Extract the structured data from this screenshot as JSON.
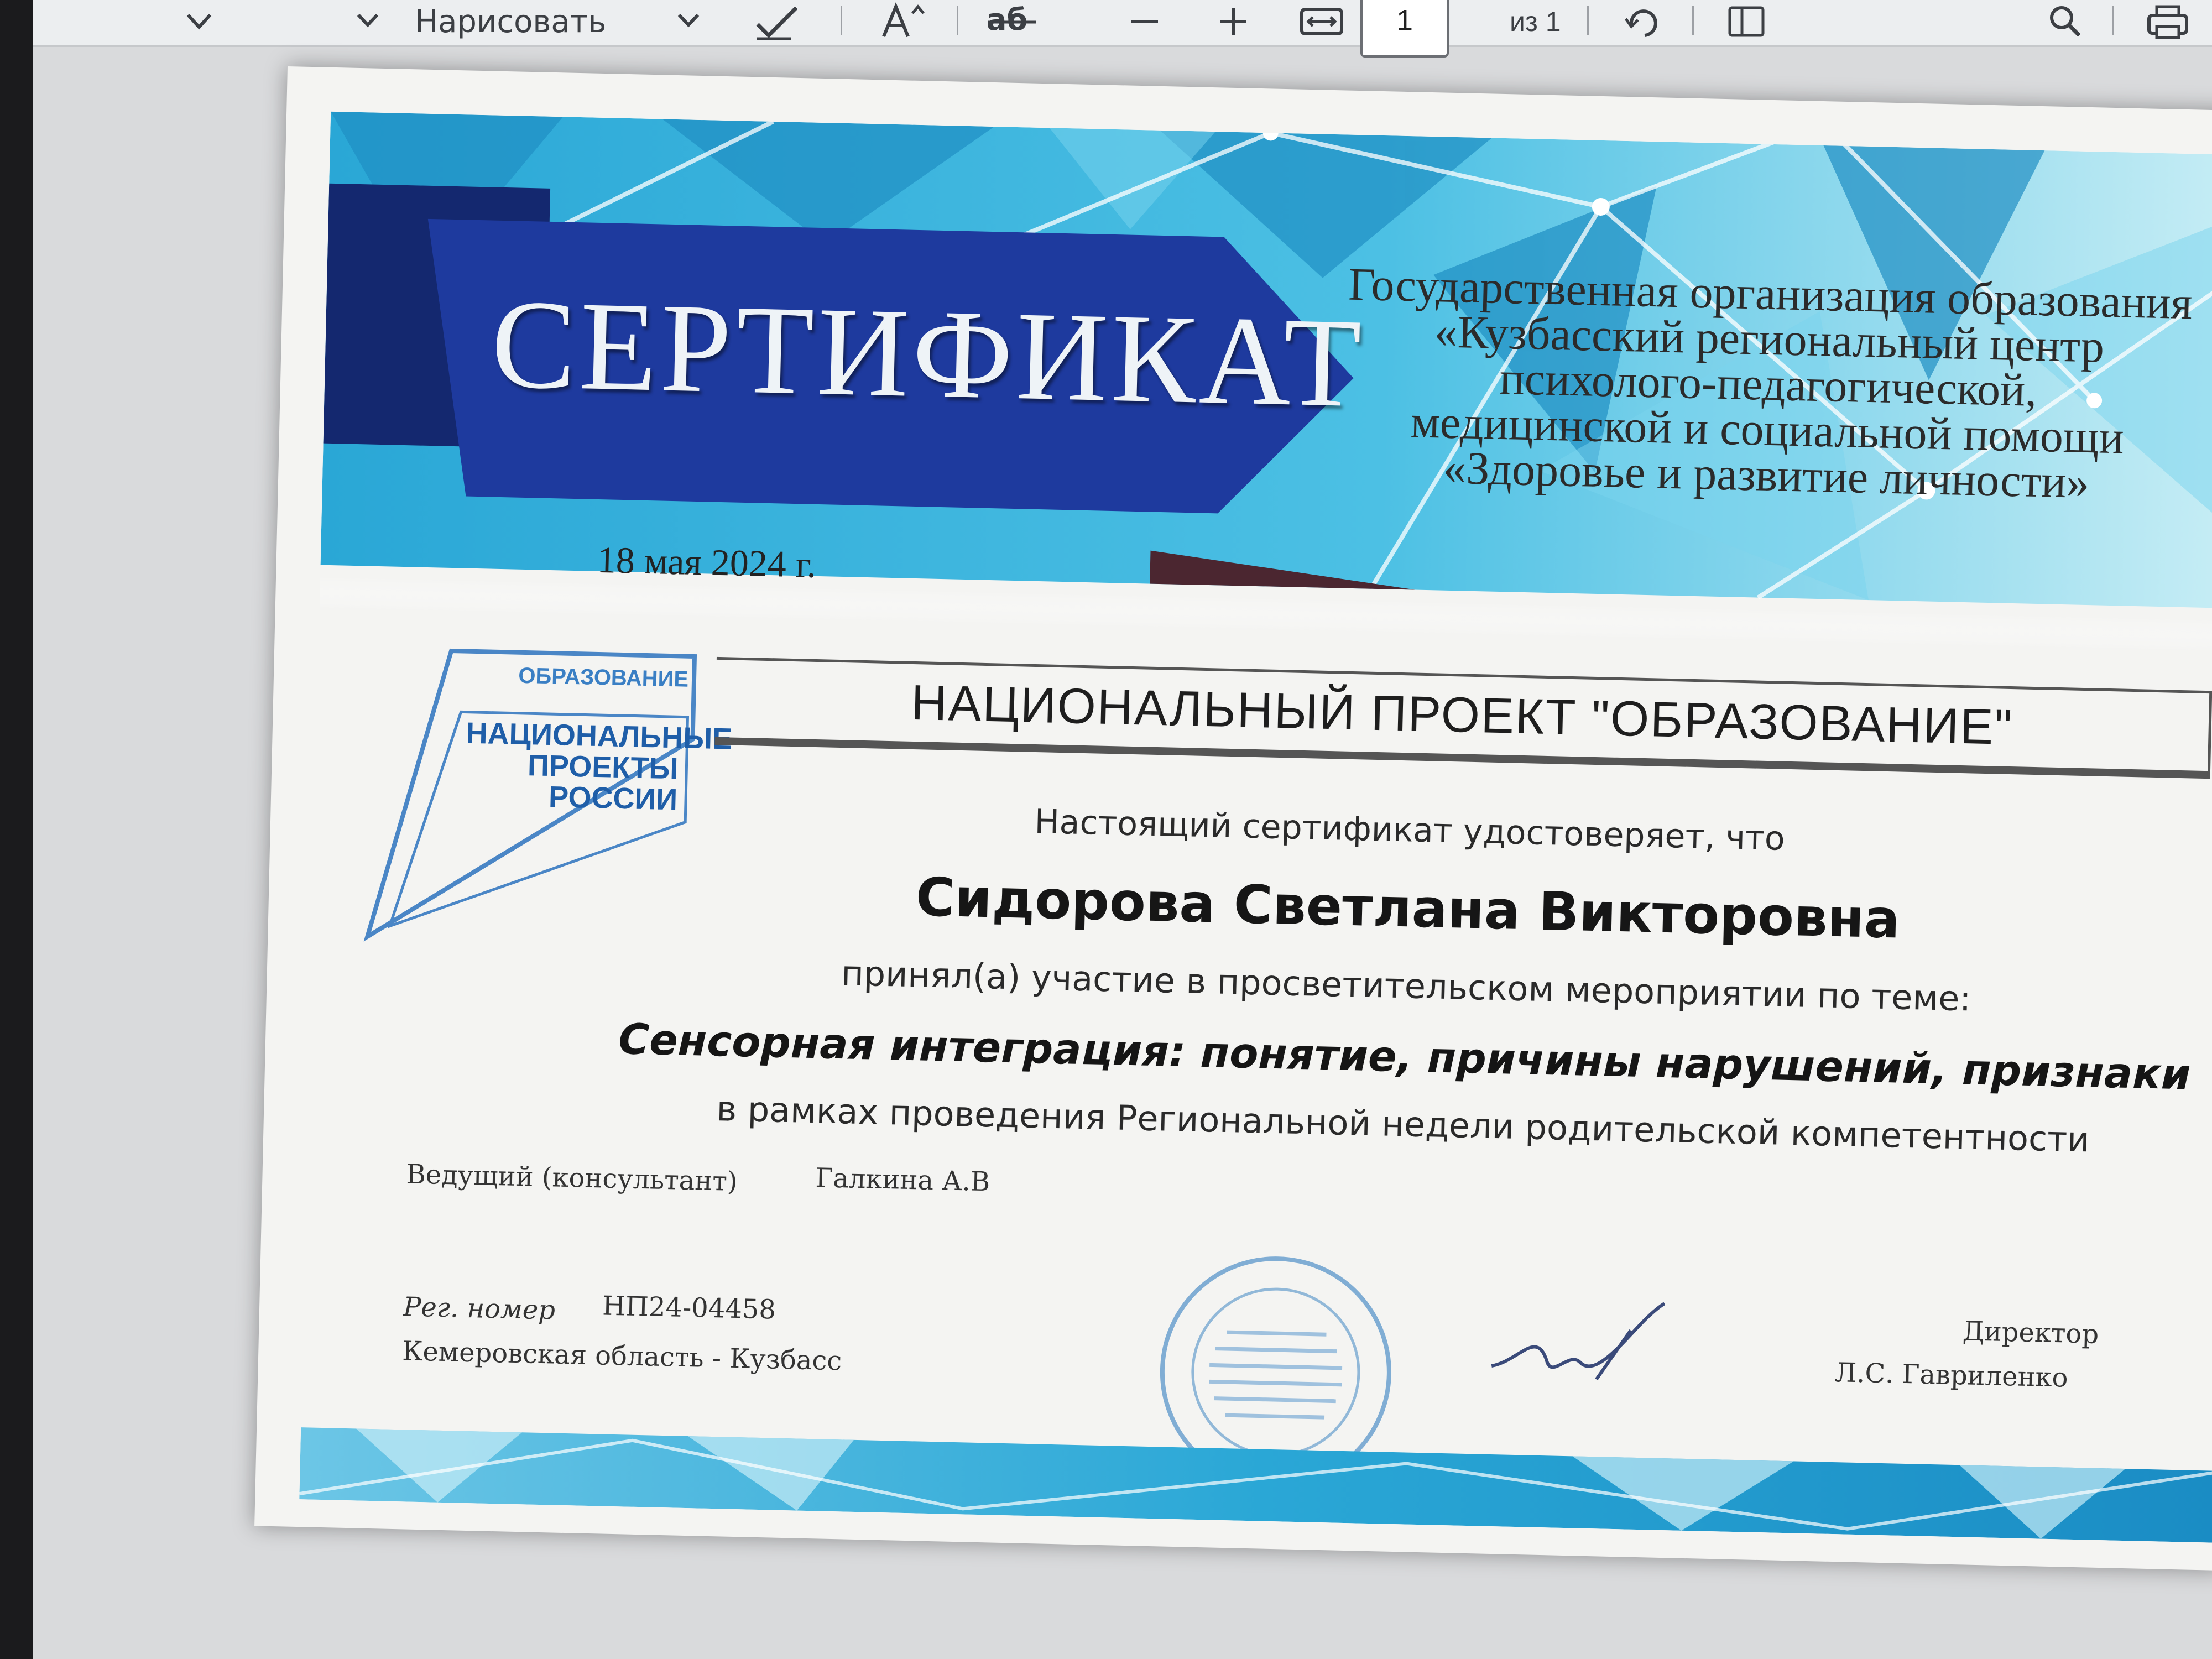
{
  "toolbar": {
    "draw_label": "Нарисовать",
    "page_number": "1",
    "page_total": "из 1"
  },
  "certificate": {
    "title": "СЕРТИФИКАТ",
    "organization_lines": [
      "Государственная организация образования",
      "«Кузбасский региональный центр",
      "психолого-педагогической,",
      "медицинской и социальной помощи",
      "«Здоровье и развитие личности»"
    ],
    "date": "18 мая 2024 г.",
    "logo": {
      "top": "ОБРАЗОВАНИЕ",
      "line1": "НАЦИОНАЛЬНЫЕ",
      "line2": "ПРОЕКТЫ",
      "line3": "РОССИИ"
    },
    "project_title": "НАЦИОНАЛЬНЫЙ ПРОЕКТ \"ОБРАЗОВАНИЕ\"",
    "intro": "Настоящий сертификат удостоверяет, что",
    "recipient": "Сидорова Светлана Викторовна",
    "participated": "принял(а) участие в просветительском мероприятии по теме:",
    "topic": "Сенсорная интеграция: понятие, причины нарушений, признаки",
    "framework": "в рамках проведения Региональной недели родительской компетентности",
    "host_label": "Ведущий (консультант)",
    "host_name": "Галкина А.В",
    "reg_label": "Рег. номер",
    "reg_number": "НП24-04458",
    "region": "Кемеровская область - Кузбасс",
    "director_label": "Директор",
    "director_name": "Л.С. Гавриленко"
  },
  "colors": {
    "banner_dark": "#1e3a9e",
    "banner_light": "#35b3dc",
    "accent_navy": "#1a2f86",
    "logo_blue": "#1f5ea8"
  },
  "icons": [
    "dropdown-arrow-icon",
    "pen-icon",
    "text-size-icon",
    "text-edit-icon",
    "zoom-out-icon",
    "zoom-in-icon",
    "fit-width-icon",
    "rotate-icon",
    "page-view-icon",
    "search-icon",
    "print-icon"
  ]
}
